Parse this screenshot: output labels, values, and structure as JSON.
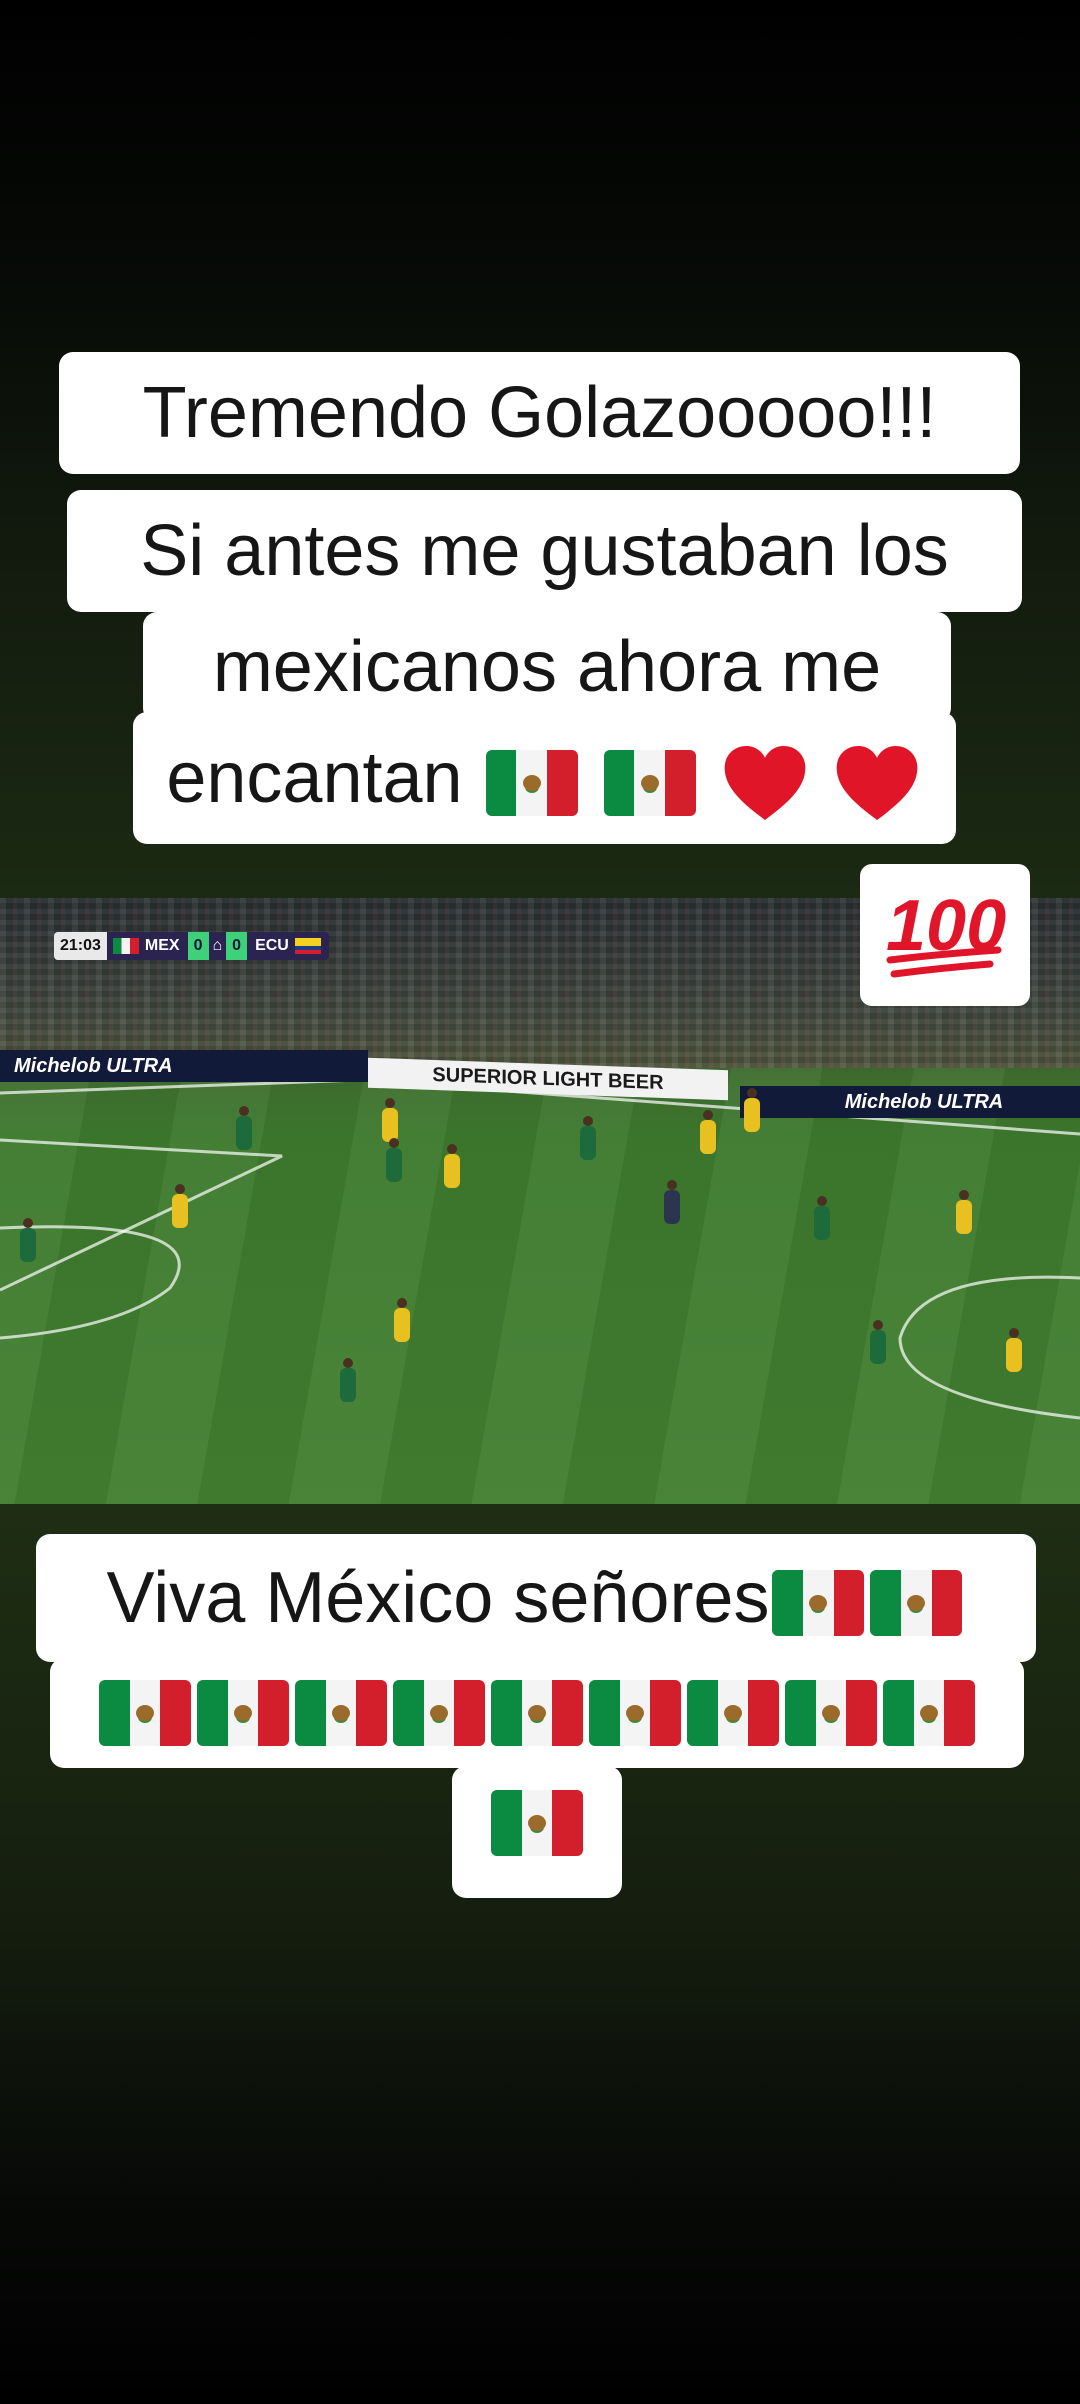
{
  "caption_top": {
    "line1": "Tremendo Golazooooo!!!",
    "line2": "Si antes me gustaban los",
    "line3": "mexicanos ahora me",
    "line4_text": "encantan"
  },
  "badge_icon": "hundred-points-emoji",
  "video": {
    "clock": "21:03",
    "team_home": "MEX",
    "score_home": "0",
    "score_away": "0",
    "team_away": "ECU",
    "ad_left": "Michelob ULTRA",
    "ad_center": "SUPERIOR LIGHT BEER",
    "ad_right": "Michelob ULTRA"
  },
  "caption_bottom": {
    "line1_text": "Viva México señores"
  },
  "colors": {
    "caption_bg": "#ffffff",
    "caption_text": "#161616",
    "flag_green": "#0b8a42",
    "flag_red": "#d21f2b",
    "heart_red": "#e01528"
  }
}
